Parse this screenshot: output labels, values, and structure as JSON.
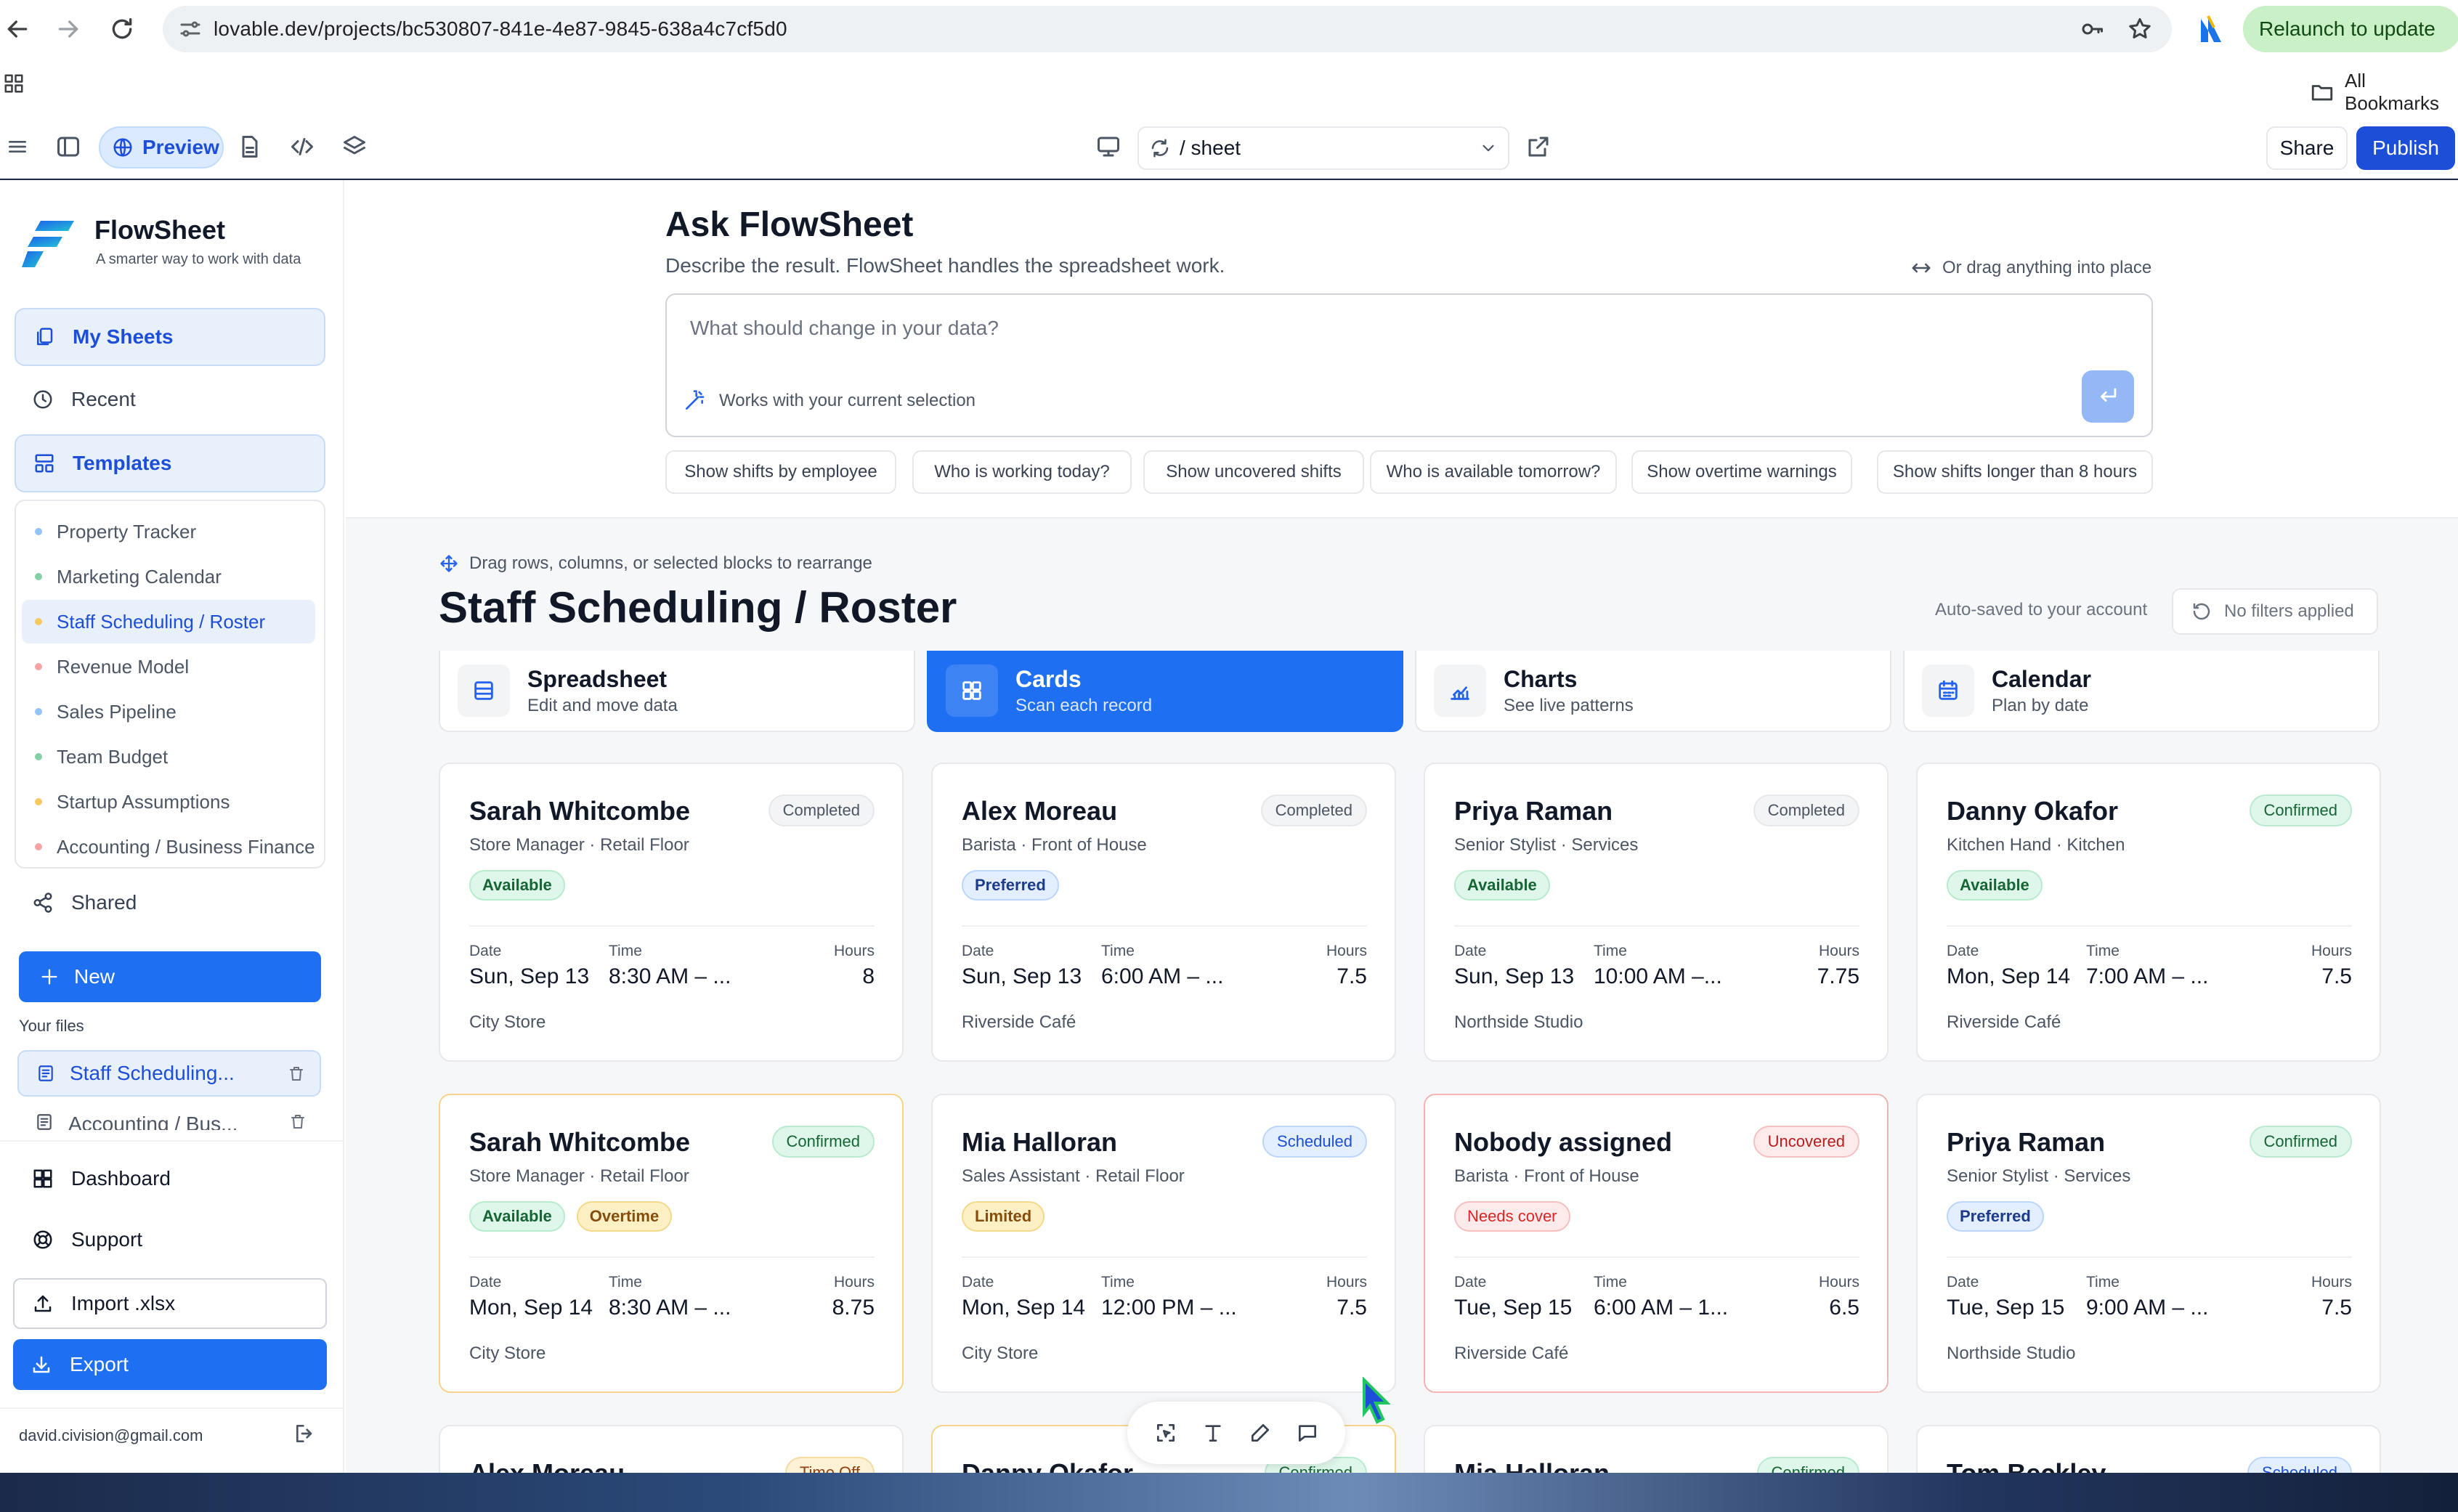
{
  "browser": {
    "url": "lovable.dev/projects/bc530807-841e-4e87-9845-638a4c7cf5d0",
    "relaunch_label": "Relaunch to update",
    "all_bookmarks": "All Bookmarks"
  },
  "toolbar": {
    "preview_label": "Preview",
    "route": "/ sheet",
    "share_label": "Share",
    "publish_label": "Publish"
  },
  "sidebar": {
    "brand": "FlowSheet",
    "tagline": "A smarter way to work with data",
    "nav": {
      "my_sheets": "My Sheets",
      "recent": "Recent",
      "templates": "Templates",
      "shared": "Shared"
    },
    "templates": [
      {
        "label": "Property Tracker",
        "dot": "#93c5fd"
      },
      {
        "label": "Marketing Calendar",
        "dot": "#86d0a8"
      },
      {
        "label": "Staff Scheduling / Roster",
        "dot": "#f5c862"
      },
      {
        "label": "Revenue Model",
        "dot": "#f5a3a3"
      },
      {
        "label": "Sales Pipeline",
        "dot": "#93c5fd"
      },
      {
        "label": "Team Budget",
        "dot": "#86d0a8"
      },
      {
        "label": "Startup Assumptions",
        "dot": "#f5c862"
      },
      {
        "label": "Accounting / Business Finance",
        "dot": "#f5a3a3"
      }
    ],
    "new_label": "New",
    "your_files_label": "Your files",
    "files": [
      "Staff Scheduling...",
      "Accounting / Bus..."
    ],
    "dashboard": "Dashboard",
    "support": "Support",
    "import_label": "Import .xlsx",
    "export_label": "Export",
    "email": "david.civision@gmail.com"
  },
  "ask": {
    "title": "Ask FlowSheet",
    "subtitle": "Describe the result. FlowSheet handles the spreadsheet work.",
    "drag_hint": "Or drag anything into place",
    "placeholder": "What should change in your data?",
    "selection_hint": "Works with your current selection",
    "chips": [
      "Show shifts by employee",
      "Who is working today?",
      "Show uncovered shifts",
      "Who is available tomorrow?",
      "Show overtime warnings",
      "Show shifts longer than 8 hours"
    ]
  },
  "sheet": {
    "drag_hint": "Drag rows, columns, or selected blocks to rearrange",
    "title": "Staff Scheduling / Roster",
    "autosaved": "Auto-saved to your account",
    "filters": "No filters applied",
    "views": [
      {
        "name": "Spreadsheet",
        "sub": "Edit and move data",
        "icon": "table-icon"
      },
      {
        "name": "Cards",
        "sub": "Scan each record",
        "icon": "grid-icon"
      },
      {
        "name": "Charts",
        "sub": "See live patterns",
        "icon": "chart-icon"
      },
      {
        "name": "Calendar",
        "sub": "Plan by date",
        "icon": "calendar-icon"
      }
    ],
    "field_labels": {
      "date": "Date",
      "time": "Time",
      "hours": "Hours"
    }
  },
  "cards": [
    {
      "name": "Sarah Whitcombe",
      "role": "Store Manager · Retail Floor",
      "status": "Completed",
      "tags": [
        "Available"
      ],
      "date": "Sun, Sep 13",
      "time": "8:30 AM – ...",
      "hours": "8",
      "location": "City Store"
    },
    {
      "name": "Alex Moreau",
      "role": "Barista · Front of House",
      "status": "Completed",
      "tags": [
        "Preferred"
      ],
      "date": "Sun, Sep 13",
      "time": "6:00 AM – ...",
      "hours": "7.5",
      "location": "Riverside Café"
    },
    {
      "name": "Priya Raman",
      "role": "Senior Stylist · Services",
      "status": "Completed",
      "tags": [
        "Available"
      ],
      "date": "Sun, Sep 13",
      "time": "10:00 AM –...",
      "hours": "7.75",
      "location": "Northside Studio"
    },
    {
      "name": "Danny Okafor",
      "role": "Kitchen Hand · Kitchen",
      "status": "Confirmed",
      "tags": [
        "Available"
      ],
      "date": "Mon, Sep 14",
      "time": "7:00 AM – ...",
      "hours": "7.5",
      "location": "Riverside Café"
    },
    {
      "name": "Sarah Whitcombe",
      "role": "Store Manager · Retail Floor",
      "status": "Confirmed",
      "tags": [
        "Available",
        "Overtime"
      ],
      "date": "Mon, Sep 14",
      "time": "8:30 AM – ...",
      "hours": "8.75",
      "location": "City Store"
    },
    {
      "name": "Mia Halloran",
      "role": "Sales Assistant · Retail Floor",
      "status": "Scheduled",
      "tags": [
        "Limited"
      ],
      "date": "Mon, Sep 14",
      "time": "12:00 PM – ...",
      "hours": "7.5",
      "location": "City Store"
    },
    {
      "name": "Nobody assigned",
      "role": "Barista · Front of House",
      "status": "Uncovered",
      "tags": [
        "Needs cover"
      ],
      "date": "Tue, Sep 15",
      "time": "6:00 AM – 1...",
      "hours": "6.5",
      "location": "Riverside Café"
    },
    {
      "name": "Priya Raman",
      "role": "Senior Stylist · Services",
      "status": "Confirmed",
      "tags": [
        "Preferred"
      ],
      "date": "Tue, Sep 15",
      "time": "9:00 AM – ...",
      "hours": "7.5",
      "location": "Northside Studio"
    },
    {
      "name": "Alex Moreau",
      "status": "Time Off"
    },
    {
      "name": "Danny Okafor",
      "status": "Confirmed"
    },
    {
      "name": "Mia Halloran",
      "status": "Confirmed"
    },
    {
      "name": "Tom Beckley",
      "status": "Scheduled"
    }
  ],
  "colors": {
    "accent": "#1f6ff2",
    "publish": "#1d4ed8",
    "relaunch": "#c9f0c6"
  }
}
